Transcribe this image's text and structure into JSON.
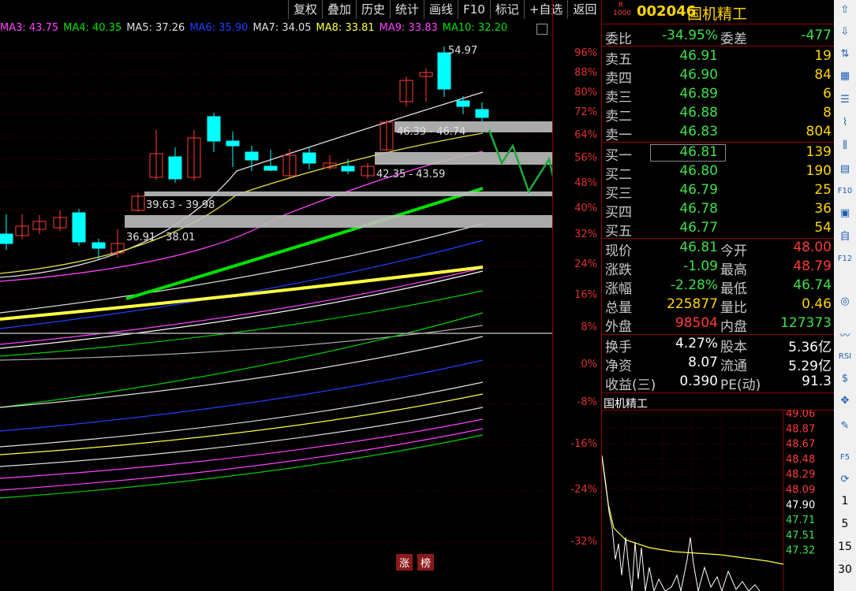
{
  "toolbar": [
    "复权",
    "叠加",
    "历史",
    "统计",
    "画线",
    "F10",
    "标记",
    "+自选",
    "返回"
  ],
  "ma_legend": [
    {
      "label": "MA3: 43.75",
      "color": "#ff40ff"
    },
    {
      "label": "MA4: 40.35",
      "color": "#00e000"
    },
    {
      "label": "MA5: 37.26",
      "color": "#e0e0e0"
    },
    {
      "label": "MA6: 35.90",
      "color": "#2040ff"
    },
    {
      "label": "MA7: 34.05",
      "color": "#e0e0e0"
    },
    {
      "label": "MA8: 33.81",
      "color": "#ffff40"
    },
    {
      "label": "MA9: 33.83",
      "color": "#ff40ff"
    },
    {
      "label": "MA10: 32.20",
      "color": "#00e000"
    }
  ],
  "pct_axis": [
    "96%",
    "88%",
    "80%",
    "72%",
    "64%",
    "56%",
    "48%",
    "40%",
    "32%",
    "24%",
    "16%",
    "8%",
    "0%",
    "-8%",
    "-16%",
    "-24%",
    "-32%"
  ],
  "annotations": {
    "peak": "54.97",
    "range1": "46.39 - 46.74",
    "range2": "42.35 - 43.59",
    "range3": "39.63 - 39.98",
    "range4": "36.91 - 38.01"
  },
  "zhang_bang": [
    "涨",
    "榜"
  ],
  "stock": {
    "code": "002046",
    "name": "国机精工",
    "badge_top": "R",
    "badge_bottom": "1000"
  },
  "weibi": {
    "label": "委比",
    "value": "-34.95%",
    "label2": "委差",
    "value2": "-477"
  },
  "asks": [
    {
      "label": "卖五",
      "price": "46.91",
      "vol": "19"
    },
    {
      "label": "卖四",
      "price": "46.90",
      "vol": "84"
    },
    {
      "label": "卖三",
      "price": "46.89",
      "vol": "6"
    },
    {
      "label": "卖二",
      "price": "46.88",
      "vol": "8"
    },
    {
      "label": "卖一",
      "price": "46.83",
      "vol": "804"
    }
  ],
  "bids": [
    {
      "label": "买一",
      "price": "46.81",
      "vol": "139"
    },
    {
      "label": "买二",
      "price": "46.80",
      "vol": "190"
    },
    {
      "label": "买三",
      "price": "46.79",
      "vol": "25"
    },
    {
      "label": "买四",
      "price": "46.78",
      "vol": "36"
    },
    {
      "label": "买五",
      "price": "46.77",
      "vol": "54"
    }
  ],
  "stats": [
    {
      "l1": "现价",
      "v1": "46.81",
      "l2": "今开",
      "v2": "48.00"
    },
    {
      "l1": "涨跌",
      "v1": "-1.09",
      "l2": "最高",
      "v2": "48.79"
    },
    {
      "l1": "涨幅",
      "v1": "-2.28%",
      "l2": "最低",
      "v2": "46.74"
    },
    {
      "l1": "总量",
      "v1": "225877",
      "l2": "量比",
      "v2": "0.46"
    },
    {
      "l1": "外盘",
      "v1": "98504",
      "l2": "内盘",
      "v2": "127373"
    }
  ],
  "stats2": [
    {
      "l1": "换手",
      "v1": "4.27%",
      "l2": "股本",
      "v2": "5.36亿"
    },
    {
      "l1": "净资",
      "v1": "8.07",
      "l2": "流通",
      "v2": "5.29亿"
    },
    {
      "l1": "收益(三)",
      "v1": "0.390",
      "l2": "PE(动)",
      "v2": "91.3"
    }
  ],
  "mini_chart": {
    "title": "国机精工",
    "axis": [
      "49.06",
      "48.87",
      "48.67",
      "48.48",
      "48.29",
      "48.09",
      "47.90",
      "47.71",
      "47.51",
      "47.32"
    ]
  },
  "tools": [
    "up-arrow-icon",
    "down-arrow-icon",
    "sort-icon",
    "table-icon",
    "list-icon",
    "trend-icon",
    "kline-icon",
    "report-icon",
    "f10-icon",
    "calc-icon",
    "self-icon",
    "f12-icon",
    "circle-icon",
    "wave-icon",
    "rsi-icon",
    "dollar-icon",
    "move-icon",
    "pen-icon",
    "f5-icon",
    "refresh-icon"
  ],
  "tool_labels": {
    "f10": "F10",
    "f12": "F12",
    "self": "自",
    "rsi": "RSI",
    "dollar": "$",
    "f5": "F5"
  },
  "periods": [
    "1",
    "5",
    "15",
    "30"
  ],
  "colors": {
    "up": "#ff3b3b",
    "down": "#00ffff",
    "bg": "#000000",
    "grid": "#8b0000"
  }
}
